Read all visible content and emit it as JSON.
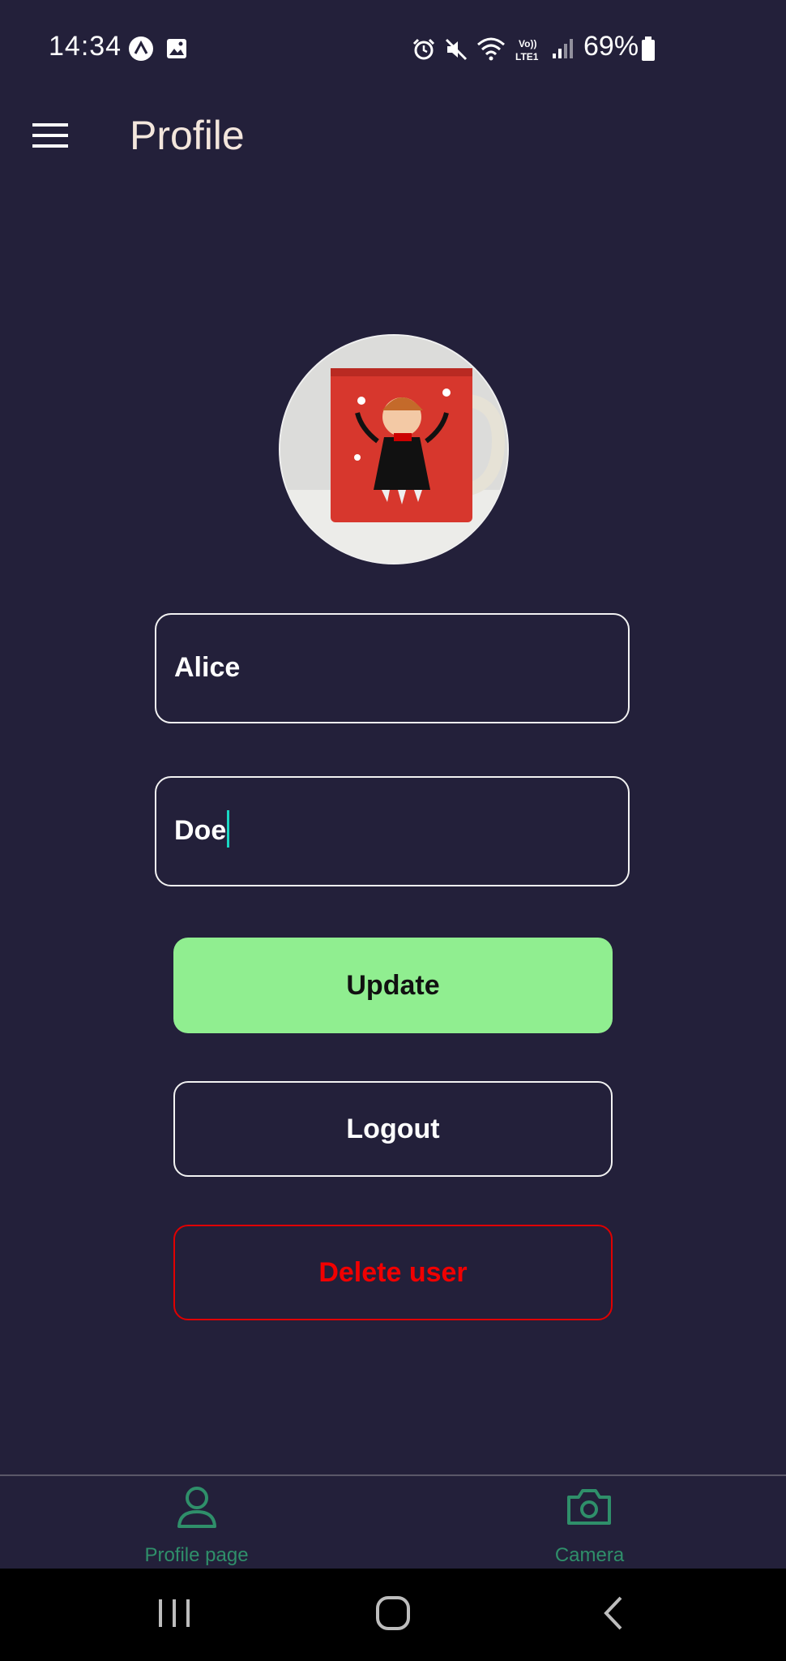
{
  "status_bar": {
    "time": "14:34",
    "battery": "69%",
    "icons": [
      "alert-app-icon",
      "gallery-icon",
      "alarm-icon",
      "mute-icon",
      "wifi-icon",
      "volte-icon",
      "signal-icon",
      "battery-icon"
    ]
  },
  "app_bar": {
    "title": "Profile",
    "menu_icon": "menu-icon"
  },
  "profile": {
    "avatar_alt": "profile photo of red mug",
    "first_name": "Alice",
    "last_name": "Doe"
  },
  "actions": {
    "update_label": "Update",
    "logout_label": "Logout",
    "delete_label": "Delete user"
  },
  "bottom_tabs": [
    {
      "label": "Profile page",
      "icon": "person-icon"
    },
    {
      "label": "Camera",
      "icon": "camera-icon"
    }
  ],
  "colors": {
    "background": "#23203a",
    "title": "#f3e6dc",
    "update_bg": "#90ee90",
    "delete": "#f10000",
    "tab_accent": "#2f8f6a",
    "caret": "#19d6c2"
  }
}
